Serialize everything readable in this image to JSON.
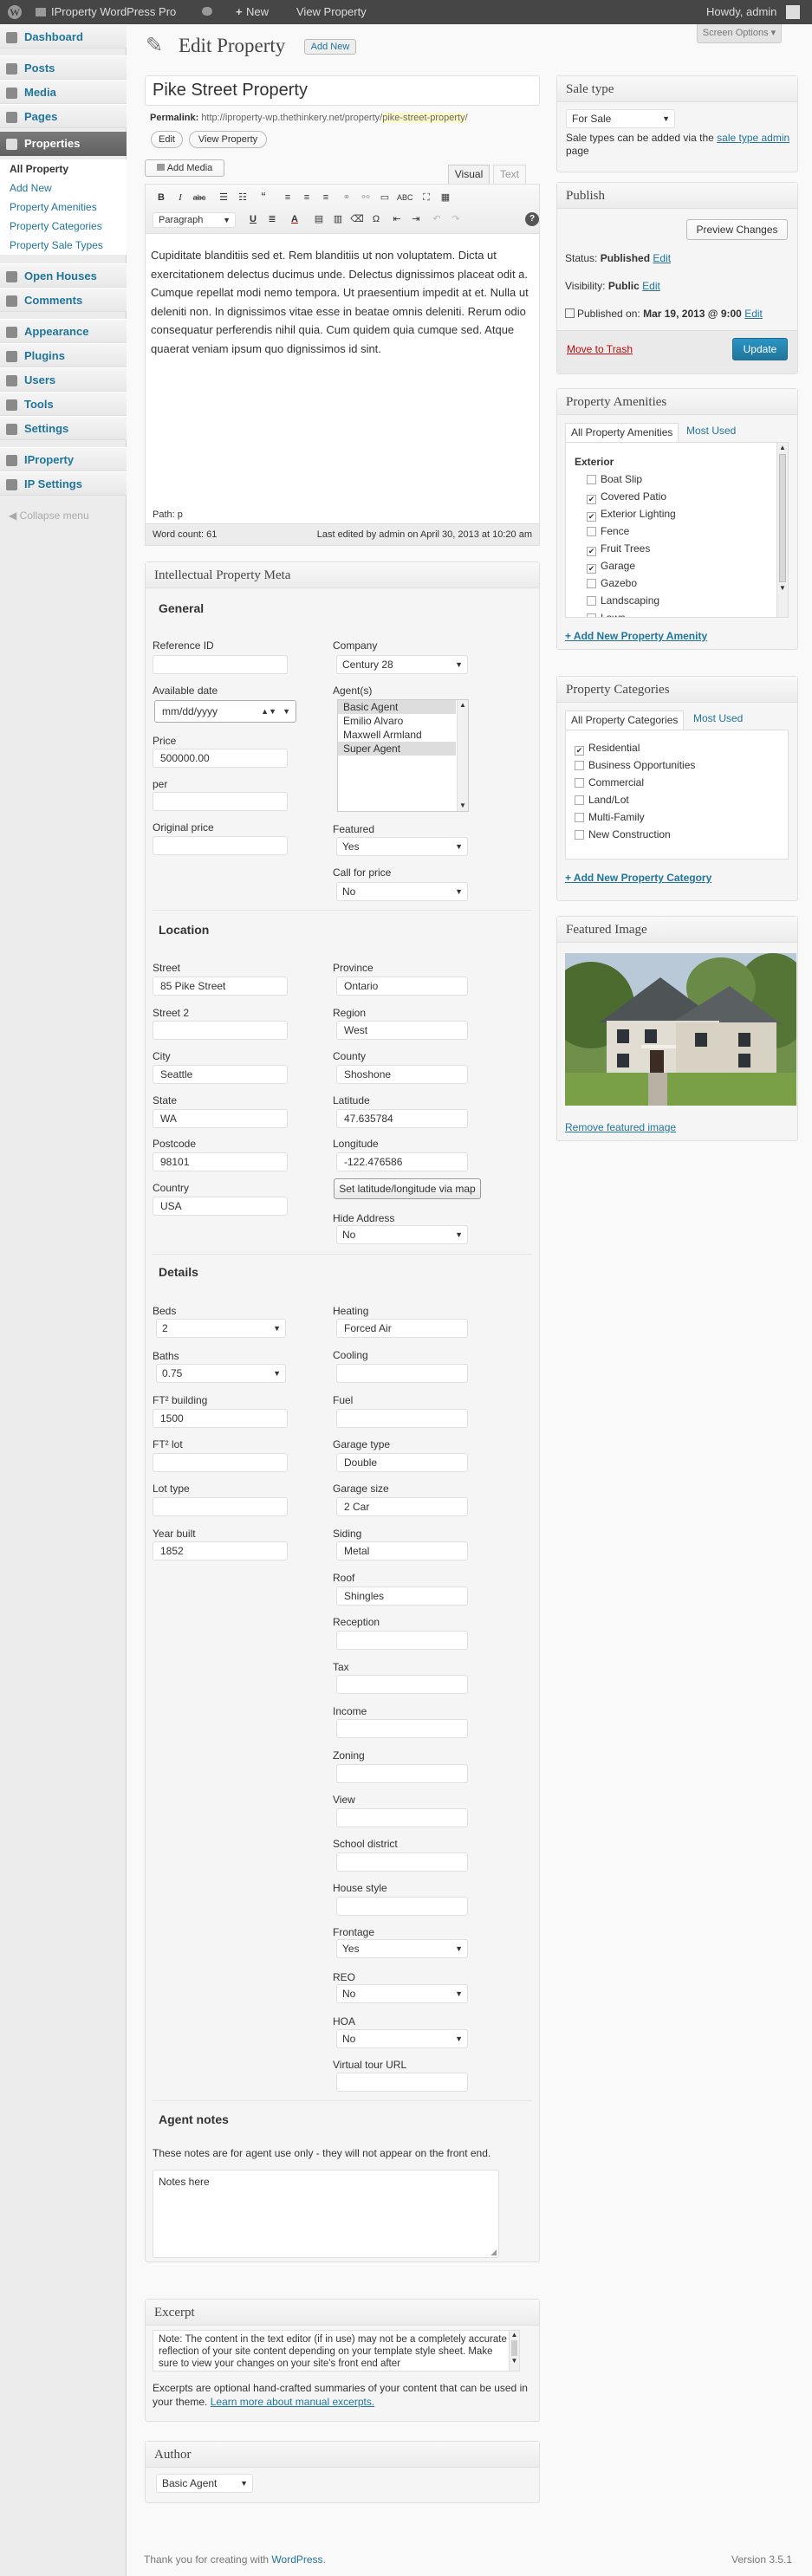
{
  "adminbar": {
    "site_name": "IProperty WordPress Pro",
    "new_label": "New",
    "view_label": "View Property",
    "howdy": "Howdy, admin",
    "screen_options": "Screen Options"
  },
  "sidebar": {
    "dashboard": "Dashboard",
    "posts": "Posts",
    "media": "Media",
    "pages": "Pages",
    "properties": "Properties",
    "sub_all": "All Property",
    "sub_add": "Add New",
    "sub_amenities": "Property Amenities",
    "sub_categories": "Property Categories",
    "sub_saletypes": "Property Sale Types",
    "open_houses": "Open Houses",
    "comments": "Comments",
    "appearance": "Appearance",
    "plugins": "Plugins",
    "users": "Users",
    "tools": "Tools",
    "settings": "Settings",
    "iproperty": "IProperty",
    "ip_settings": "IP Settings",
    "collapse": "Collapse menu"
  },
  "page": {
    "title": "Edit Property",
    "add_new": "Add New",
    "post_title": "Pike Street Property",
    "permalink_label": "Permalink:",
    "permalink_base": "http://iproperty-wp.thethinkery.net/property/",
    "permalink_slug": "pike-street-property",
    "edit_btn": "Edit",
    "view_btn": "View Property"
  },
  "editor": {
    "add_media": "Add Media",
    "tab_visual": "Visual",
    "tab_text": "Text",
    "format": "Paragraph",
    "content": "Cupiditate blanditiis sed et. Rem blanditiis ut non voluptatem. Dicta ut exercitationem delectus ducimus unde. Delectus dignissimos placeat odit a. Cumque repellat modi nemo tempora. Ut praesentium impedit at et. Nulla ut deleniti non. In dignissimos vitae esse in beatae omnis deleniti. Rerum odio consequatur perferendis nihil quia. Cum quidem quia cumque sed. Atque quaerat veniam ipsum quo dignissimos id sint.",
    "path": "Path: p",
    "word_count": "Word count: 61",
    "last_edited": "Last edited by admin on April 30, 2013 at 10:20 am"
  },
  "meta": {
    "title": "Intellectual Property Meta",
    "general": "General",
    "reference_id_label": "Reference ID",
    "reference_id": "",
    "company_label": "Company",
    "company": "Century 28",
    "available_date_label": "Available date",
    "available_date_placeholder": "mm/dd/yyyy",
    "agents_label": "Agent(s)",
    "agents": [
      "Basic Agent",
      "Emilio Alvaro",
      "Maxwell Armland",
      "Super Agent"
    ],
    "price_label": "Price",
    "price": "500000.00",
    "per_label": "per",
    "per": "",
    "original_price_label": "Original price",
    "original_price": "",
    "featured_label": "Featured",
    "featured": "Yes",
    "call_for_price_label": "Call for price",
    "call_for_price": "No",
    "location": "Location",
    "street_label": "Street",
    "street": "85 Pike Street",
    "province_label": "Province",
    "province": "Ontario",
    "street2_label": "Street 2",
    "street2": "",
    "region_label": "Region",
    "region": "West",
    "city_label": "City",
    "city": "Seattle",
    "county_label": "County",
    "county": "Shoshone",
    "state_label": "State",
    "state": "WA",
    "latitude_label": "Latitude",
    "latitude": "47.635784",
    "postcode_label": "Postcode",
    "postcode": "98101",
    "longitude_label": "Longitude",
    "longitude": "-122.476586",
    "country_label": "Country",
    "country": "USA",
    "set_latlng_btn": "Set latitude/longitude via map",
    "hide_address_label": "Hide Address",
    "hide_address": "No",
    "details": "Details",
    "beds_label": "Beds",
    "beds": "2",
    "baths_label": "Baths",
    "baths": "0.75",
    "ft2_building_label": "FT² building",
    "ft2_building": "1500",
    "ft2_lot_label": "FT² lot",
    "ft2_lot": "",
    "lot_type_label": "Lot type",
    "lot_type": "",
    "year_built_label": "Year built",
    "year_built": "1852",
    "heating_label": "Heating",
    "heating": "Forced Air",
    "cooling_label": "Cooling",
    "cooling": "",
    "fuel_label": "Fuel",
    "fuel": "",
    "garage_type_label": "Garage type",
    "garage_type": "Double",
    "garage_size_label": "Garage size",
    "garage_size": "2 Car",
    "siding_label": "Siding",
    "siding": "Metal",
    "roof_label": "Roof",
    "roof": "Shingles",
    "reception_label": "Reception",
    "reception": "",
    "tax_label": "Tax",
    "tax": "",
    "income_label": "Income",
    "income": "",
    "zoning_label": "Zoning",
    "zoning": "",
    "view_label": "View",
    "view": "",
    "school_district_label": "School district",
    "school_district": "",
    "house_style_label": "House style",
    "house_style": "",
    "frontage_label": "Frontage",
    "frontage": "Yes",
    "reo_label": "REO",
    "reo": "No",
    "hoa_label": "HOA",
    "hoa": "No",
    "virtual_tour_label": "Virtual tour URL",
    "virtual_tour": "",
    "agent_notes": "Agent notes",
    "agent_notes_hint": "These notes are for agent use only - they will not appear on the front end.",
    "agent_notes_value": "Notes here"
  },
  "excerpt": {
    "title": "Excerpt",
    "value": "Note: The content in the text editor (if in use) may not be a completely accurate reflection of your site content depending on your template style sheet. Make sure to view your changes on your site's front end after",
    "help_text": "Excerpts are optional hand-crafted summaries of your content that can be used in your theme.",
    "help_link": "Learn more about manual excerpts."
  },
  "author": {
    "title": "Author",
    "value": "Basic Agent"
  },
  "saletype": {
    "title": "Sale type",
    "value": "For Sale",
    "note1": "Sale types can be added via the",
    "note_link": "sale type admin",
    "note2": "page"
  },
  "publish": {
    "title": "Publish",
    "preview": "Preview Changes",
    "status_label": "Status:",
    "status": "Published",
    "visibility_label": "Visibility:",
    "visibility": "Public",
    "published_label": "Published on:",
    "published": "Mar 19, 2013 @ 9:00",
    "edit": "Edit",
    "trash": "Move to Trash",
    "update": "Update"
  },
  "amenities": {
    "title": "Property Amenities",
    "tab_all": "All Property Amenities",
    "tab_most": "Most Used",
    "group": "Exterior",
    "items": [
      {
        "label": "Boat Slip",
        "checked": false
      },
      {
        "label": "Covered Patio",
        "checked": true
      },
      {
        "label": "Exterior Lighting",
        "checked": true
      },
      {
        "label": "Fence",
        "checked": false
      },
      {
        "label": "Fruit Trees",
        "checked": true
      },
      {
        "label": "Garage",
        "checked": true
      },
      {
        "label": "Gazebo",
        "checked": false
      },
      {
        "label": "Landscaping",
        "checked": false
      },
      {
        "label": "Lawn",
        "checked": false
      }
    ],
    "add_new": "+ Add New Property Amenity"
  },
  "categories": {
    "title": "Property Categories",
    "tab_all": "All Property Categories",
    "tab_most": "Most Used",
    "items": [
      {
        "label": "Residential",
        "checked": true
      },
      {
        "label": "Business Opportunities",
        "checked": false
      },
      {
        "label": "Commercial",
        "checked": false
      },
      {
        "label": "Land/Lot",
        "checked": false
      },
      {
        "label": "Multi-Family",
        "checked": false
      },
      {
        "label": "New Construction",
        "checked": false
      }
    ],
    "add_new": "+ Add New Property Category"
  },
  "featured_image": {
    "title": "Featured Image",
    "remove": "Remove featured image"
  },
  "footer": {
    "thanks": "Thank you for creating with",
    "wordpress": "WordPress",
    "version": "Version 3.5.1"
  },
  "colors": {
    "link": "#21759b",
    "primary_button": "#21759b",
    "trash": "#bc0b0b",
    "admin_bar": "#464646"
  }
}
